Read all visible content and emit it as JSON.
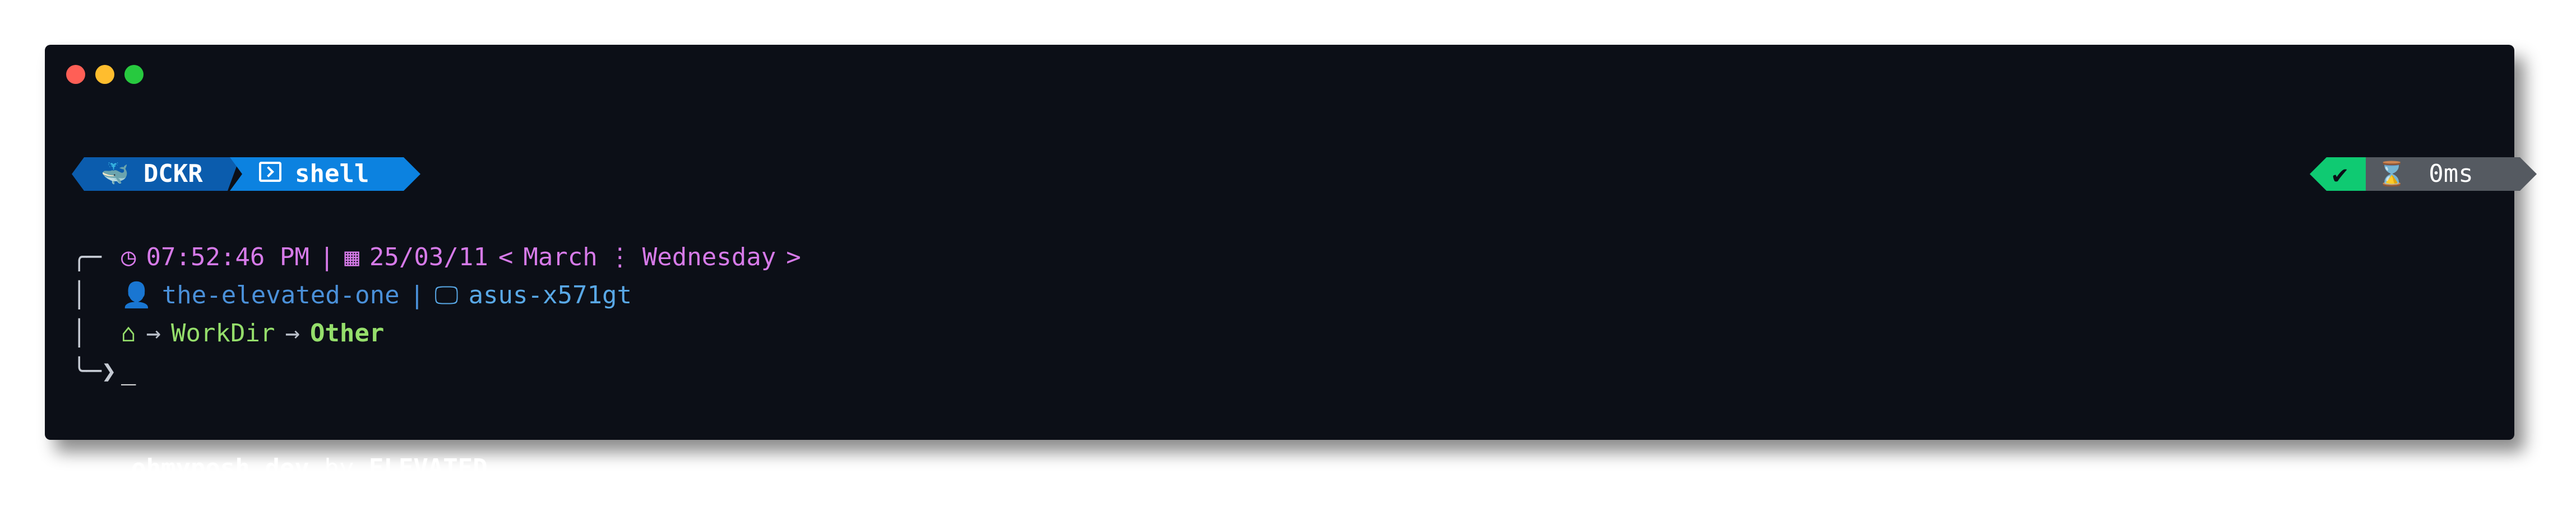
{
  "window": {
    "controls": [
      "close",
      "minimize",
      "maximize"
    ]
  },
  "prompt": {
    "left_segments": [
      {
        "icon": "docker-whale-icon",
        "glyph": "🐳",
        "label": "DCKR",
        "color": "#0b5cad"
      },
      {
        "icon": "terminal-icon",
        "label": "shell",
        "color": "#0c82e0"
      }
    ],
    "right_segments": [
      {
        "icon": "check-icon",
        "glyph": "✔",
        "color": "#0fca72"
      },
      {
        "icon": "hourglass-icon",
        "glyph": "⌛",
        "label": "0ms",
        "color": "#555a61"
      }
    ],
    "line1": {
      "frame": "╭─",
      "clock_glyph": "◷",
      "time": "07:52:46 PM",
      "sep": "|",
      "calendar_glyph": "▦",
      "date": "25/03/11",
      "lt": "<",
      "month": "March",
      "dots": "⋮",
      "weekday": "Wednesday",
      "gt": ">"
    },
    "line2": {
      "frame": "│",
      "user_glyph": "👤",
      "user": "the-elevated-one",
      "sep": "|",
      "monitor_glyph": "🖵",
      "host": "asus-x571gt"
    },
    "line3": {
      "frame": "│",
      "home_glyph": "⌂",
      "arrow1": "→",
      "dir1": "WorkDir",
      "arrow2": "→",
      "dir2": "Other"
    },
    "line4": {
      "frame": "╰─❯",
      "cursor": "_"
    }
  },
  "credits": {
    "site": "ohmyposh.dev",
    "by": "by",
    "author": "ELEVATED"
  }
}
